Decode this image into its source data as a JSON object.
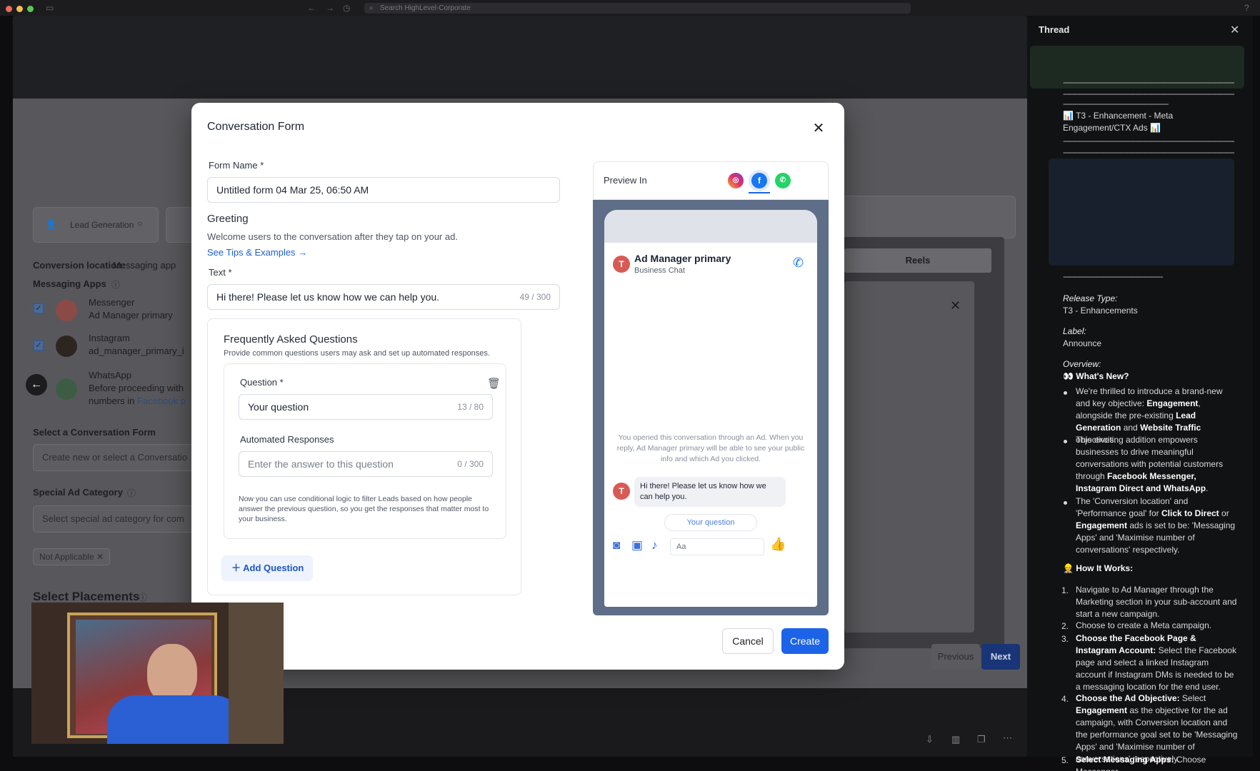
{
  "browser": {
    "search_placeholder": "Search HighLevel-Corporate"
  },
  "background": {
    "lead_generation_label": "Lead Generation",
    "conversion_location_label": "Conversion location:",
    "conversion_location_value": "Messaging app",
    "messaging_apps_label": "Messaging Apps",
    "apps": [
      {
        "name": "Messenger",
        "detail": "Ad Manager primary"
      },
      {
        "name": "Instagram",
        "detail": "ad_manager_primary_i"
      },
      {
        "name": "WhatsApp",
        "detail": "Before proceeding with",
        "detail2_a": "numbers in ",
        "detail2_b": "Facebook p"
      }
    ],
    "select_form_label": "Select a Conversation Form",
    "select_form_placeholder": "Create new or select a Conversatio",
    "special_ad_label": "Special Ad Category",
    "special_ad_placeholder": "Select special ad category for com",
    "not_applicable": "Not Applicable",
    "select_placements": "Select Placements",
    "reels": "Reels",
    "previous": "Previous",
    "next": "Next"
  },
  "modal": {
    "title": "Conversation Form",
    "form_name_label": "Form Name *",
    "form_name_value": "Untitled form 04 Mar 25, 06:50 AM",
    "greeting_heading": "Greeting",
    "greeting_desc": "Welcome users to the conversation after they tap on your ad.",
    "tips_link": "See Tips & Examples",
    "text_label": "Text *",
    "text_value": "Hi there! Please let us know how we can help you.",
    "text_count": "49 / 300",
    "faq_heading": "Frequently Asked Questions",
    "faq_desc": "Provide common questions users may ask and set up automated responses.",
    "question_label": "Question *",
    "question_value": "Your question",
    "question_count": "13 / 80",
    "auto_label": "Automated Responses",
    "auto_placeholder": "Enter the answer to this question",
    "auto_count": "0 / 300",
    "conditional_note": "Now you can use conditional logic to filter Leads based on how people answer the previous question, so you get the responses that matter most to your business.",
    "add_question": "Add Question",
    "cancel": "Cancel",
    "create": "Create"
  },
  "preview": {
    "label": "Preview In",
    "page_name": "Ad Manager primary",
    "page_sub": "Business Chat",
    "avatar_letter": "T",
    "notice": "You opened this conversation through an Ad. When you reply, Ad Manager primary will be able to see your public info and which Ad you clicked.",
    "greeting_bubble": "Hi there! Please let us know how we can help you.",
    "quick_reply": "Your question",
    "compose_placeholder": "Aa"
  },
  "thread": {
    "title": "Thread",
    "enh_title": "T3 - Enhancement - Meta Engagement/CTX Ads",
    "release_type_label": "Release Type:",
    "release_type_value": "T3 - Enhancements",
    "label_label": "Label:",
    "label_value": "Announce",
    "overview_label": "Overview:",
    "whats_new": "What's New?",
    "how_it_works": "How It Works:",
    "dash_line": "----------------------------------------------------------------------------------------------------"
  },
  "colors": {
    "primary_blue": "#1c63e8",
    "link_blue": "#1c5fd6",
    "thread_bg": "#111214",
    "avatar_red": "#d85a55"
  }
}
